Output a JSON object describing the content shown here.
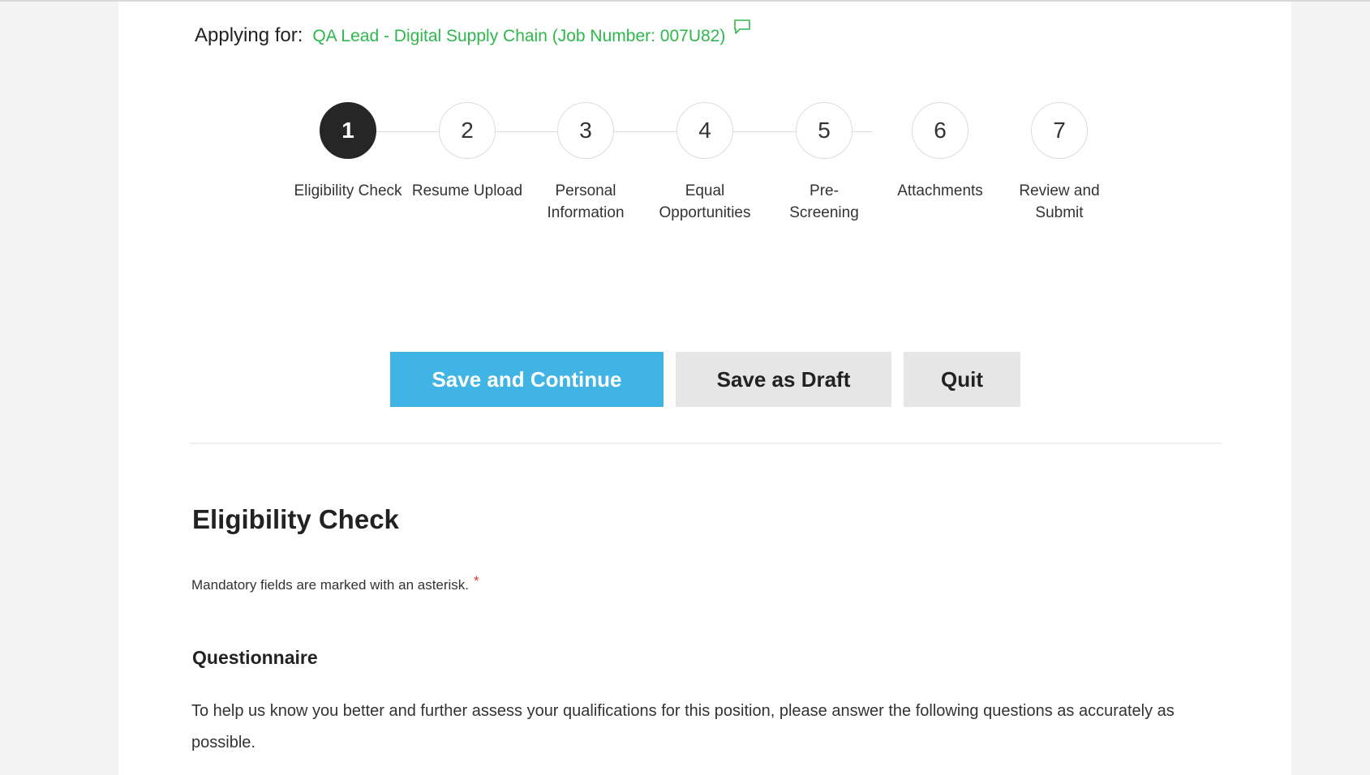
{
  "header": {
    "applying_label": "Applying for:",
    "job_title": "QA Lead - Digital Supply Chain (Job Number: 007U82)",
    "job_color": "#2db84d"
  },
  "steps": [
    {
      "number": "1",
      "label": "Eligibility Check",
      "active": true
    },
    {
      "number": "2",
      "label": "Resume Upload",
      "active": false
    },
    {
      "number": "3",
      "label": "Personal Information",
      "active": false
    },
    {
      "number": "4",
      "label": "Equal Opportunities",
      "active": false
    },
    {
      "number": "5",
      "label": "Pre-Screening",
      "active": false
    },
    {
      "number": "6",
      "label": "Attachments",
      "active": false
    },
    {
      "number": "7",
      "label": "Review and Submit",
      "active": false
    }
  ],
  "buttons": {
    "save_continue": "Save and Continue",
    "save_draft": "Save as Draft",
    "quit": "Quit",
    "primary_color": "#40b4e5"
  },
  "section": {
    "title": "Eligibility Check",
    "mandatory_note": "Mandatory fields are marked with an asterisk.",
    "asterisk": "*",
    "questionnaire_title": "Questionnaire",
    "questionnaire_intro": "To help us know you better and further assess your qualifications for this position, please answer the following questions as accurately as possible."
  },
  "icons": {
    "job_comment": "speech-bubble-icon"
  }
}
